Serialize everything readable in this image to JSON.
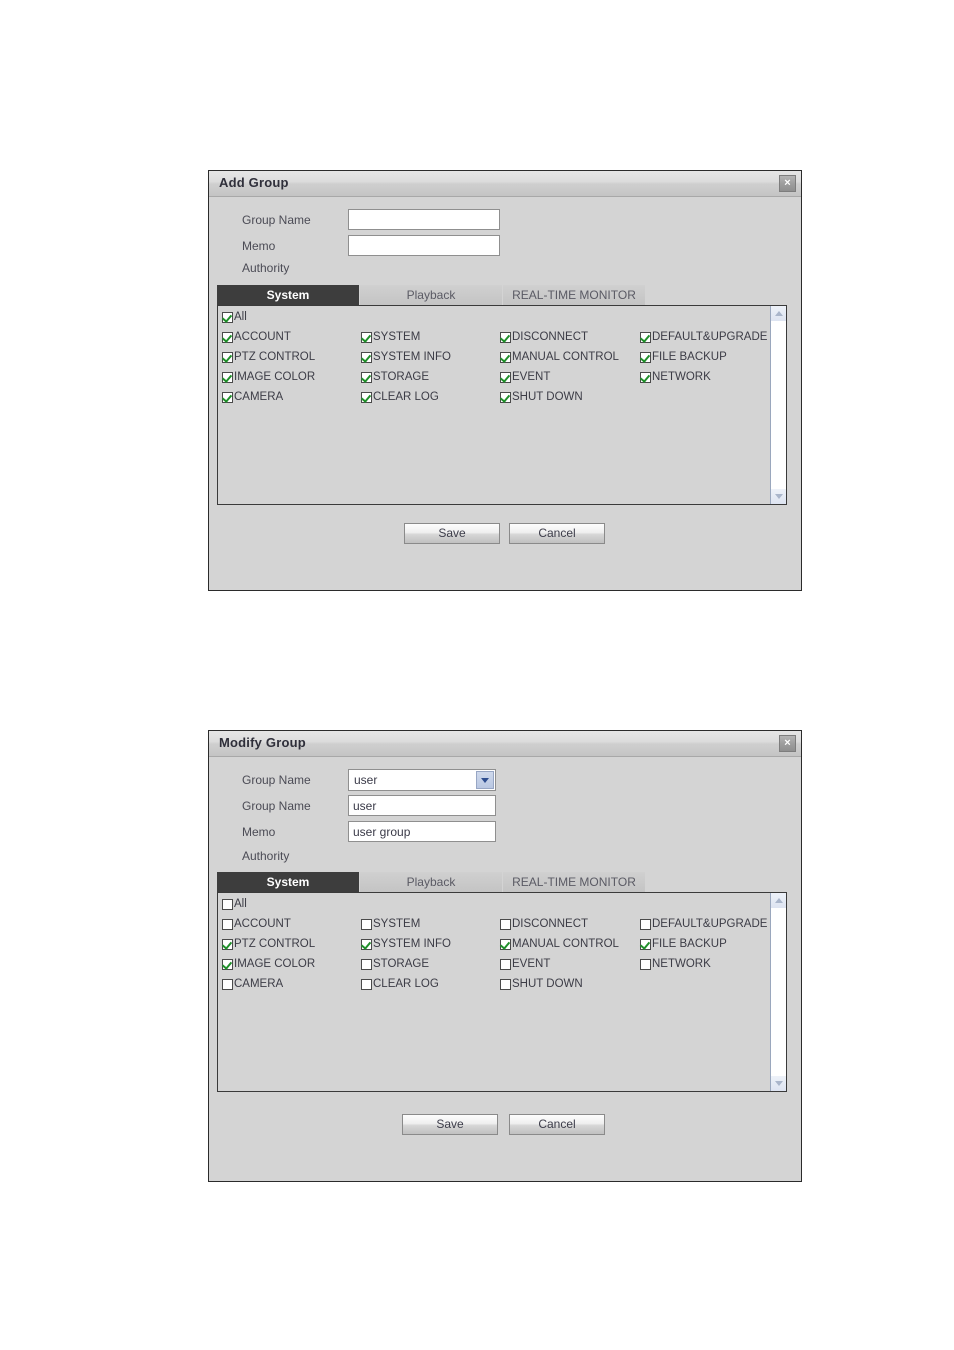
{
  "dialogs": [
    {
      "id": "add",
      "title": "Add Group",
      "close_label": "×",
      "fields": {
        "group_name_label": "Group Name",
        "group_name_value": "",
        "group_name_placeholder": "",
        "memo_label": "Memo",
        "memo_value": "",
        "memo_placeholder": "",
        "authority_label": "Authority"
      },
      "tabs": [
        {
          "label": "System",
          "active": true
        },
        {
          "label": "Playback",
          "active": false
        },
        {
          "label": "REAL-TIME MONITOR",
          "active": false
        }
      ],
      "all_checkbox": {
        "label": "All",
        "checked": true
      },
      "permissions": [
        {
          "label": "ACCOUNT",
          "checked": true
        },
        {
          "label": "SYSTEM",
          "checked": true
        },
        {
          "label": "DISCONNECT",
          "checked": true
        },
        {
          "label": "DEFAULT&UPGRADE",
          "checked": true
        },
        {
          "label": "PTZ CONTROL",
          "checked": true
        },
        {
          "label": "SYSTEM INFO",
          "checked": true
        },
        {
          "label": "MANUAL CONTROL",
          "checked": true
        },
        {
          "label": "FILE BACKUP",
          "checked": true
        },
        {
          "label": "IMAGE COLOR",
          "checked": true
        },
        {
          "label": "STORAGE",
          "checked": true
        },
        {
          "label": "EVENT",
          "checked": true
        },
        {
          "label": "NETWORK",
          "checked": true
        },
        {
          "label": "CAMERA",
          "checked": true
        },
        {
          "label": "CLEAR LOG",
          "checked": true
        },
        {
          "label": "SHUT DOWN",
          "checked": true
        }
      ],
      "buttons": {
        "save": "Save",
        "cancel": "Cancel"
      }
    },
    {
      "id": "modify",
      "title": "Modify Group",
      "close_label": "×",
      "fields": {
        "group_select_label": "Group Name",
        "group_select_value": "user",
        "group_name_label": "Group Name",
        "group_name_value": "user",
        "memo_label": "Memo",
        "memo_value": "user group",
        "authority_label": "Authority"
      },
      "tabs": [
        {
          "label": "System",
          "active": true
        },
        {
          "label": "Playback",
          "active": false
        },
        {
          "label": "REAL-TIME MONITOR",
          "active": false
        }
      ],
      "all_checkbox": {
        "label": "All",
        "checked": false
      },
      "permissions": [
        {
          "label": "ACCOUNT",
          "checked": false
        },
        {
          "label": "SYSTEM",
          "checked": false
        },
        {
          "label": "DISCONNECT",
          "checked": false
        },
        {
          "label": "DEFAULT&UPGRADE",
          "checked": false
        },
        {
          "label": "PTZ CONTROL",
          "checked": true
        },
        {
          "label": "SYSTEM INFO",
          "checked": true
        },
        {
          "label": "MANUAL CONTROL",
          "checked": true
        },
        {
          "label": "FILE BACKUP",
          "checked": true
        },
        {
          "label": "IMAGE COLOR",
          "checked": true
        },
        {
          "label": "STORAGE",
          "checked": false
        },
        {
          "label": "EVENT",
          "checked": false
        },
        {
          "label": "NETWORK",
          "checked": false
        },
        {
          "label": "CAMERA",
          "checked": false
        },
        {
          "label": "CLEAR LOG",
          "checked": false
        },
        {
          "label": "SHUT DOWN",
          "checked": false
        }
      ],
      "buttons": {
        "save": "Save",
        "cancel": "Cancel"
      }
    }
  ],
  "colors": {
    "dialog_bg": "#d4d4d4",
    "active_tab_bg": "#3d3d3d",
    "check_green": "#1f8f2a",
    "border": "#2b2b2b"
  }
}
